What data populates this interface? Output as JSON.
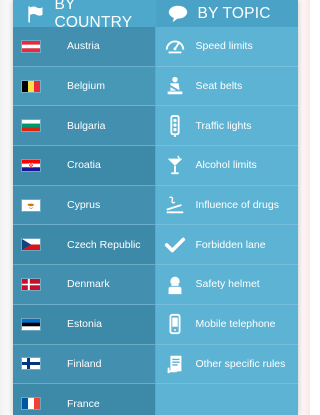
{
  "header": {
    "country_tab_label": "BY COUNTRY",
    "topic_tab_label": "BY TOPIC"
  },
  "countries": [
    {
      "name": "Austria",
      "flag": "austria-flag"
    },
    {
      "name": "Belgium",
      "flag": "belgium-flag"
    },
    {
      "name": "Bulgaria",
      "flag": "bulgaria-flag"
    },
    {
      "name": "Croatia",
      "flag": "croatia-flag"
    },
    {
      "name": "Cyprus",
      "flag": "cyprus-flag"
    },
    {
      "name": "Czech Republic",
      "flag": "czech-republic-flag"
    },
    {
      "name": "Denmark",
      "flag": "denmark-flag"
    },
    {
      "name": "Estonia",
      "flag": "estonia-flag"
    },
    {
      "name": "Finland",
      "flag": "finland-flag"
    },
    {
      "name": "France",
      "flag": "france-flag"
    }
  ],
  "topics": [
    {
      "label": "Speed limits",
      "icon": "speedometer-icon"
    },
    {
      "label": "Seat belts",
      "icon": "seat-belt-icon"
    },
    {
      "label": "Traffic lights",
      "icon": "traffic-light-icon"
    },
    {
      "label": "Alcohol limits",
      "icon": "cocktail-glass-icon"
    },
    {
      "label": "Influence of drugs",
      "icon": "drugs-icon"
    },
    {
      "label": "Forbidden lane",
      "icon": "checkmark-icon"
    },
    {
      "label": "Safety helmet",
      "icon": "helmet-rider-icon"
    },
    {
      "label": "Mobile telephone",
      "icon": "mobile-phone-icon"
    },
    {
      "label": "Other specific rules",
      "icon": "rules-document-icon"
    }
  ],
  "colors": {
    "header": "#4da6c9",
    "country_column": "#3f8fad",
    "topic_column": "#5db3d4",
    "text": "#ffffff"
  }
}
